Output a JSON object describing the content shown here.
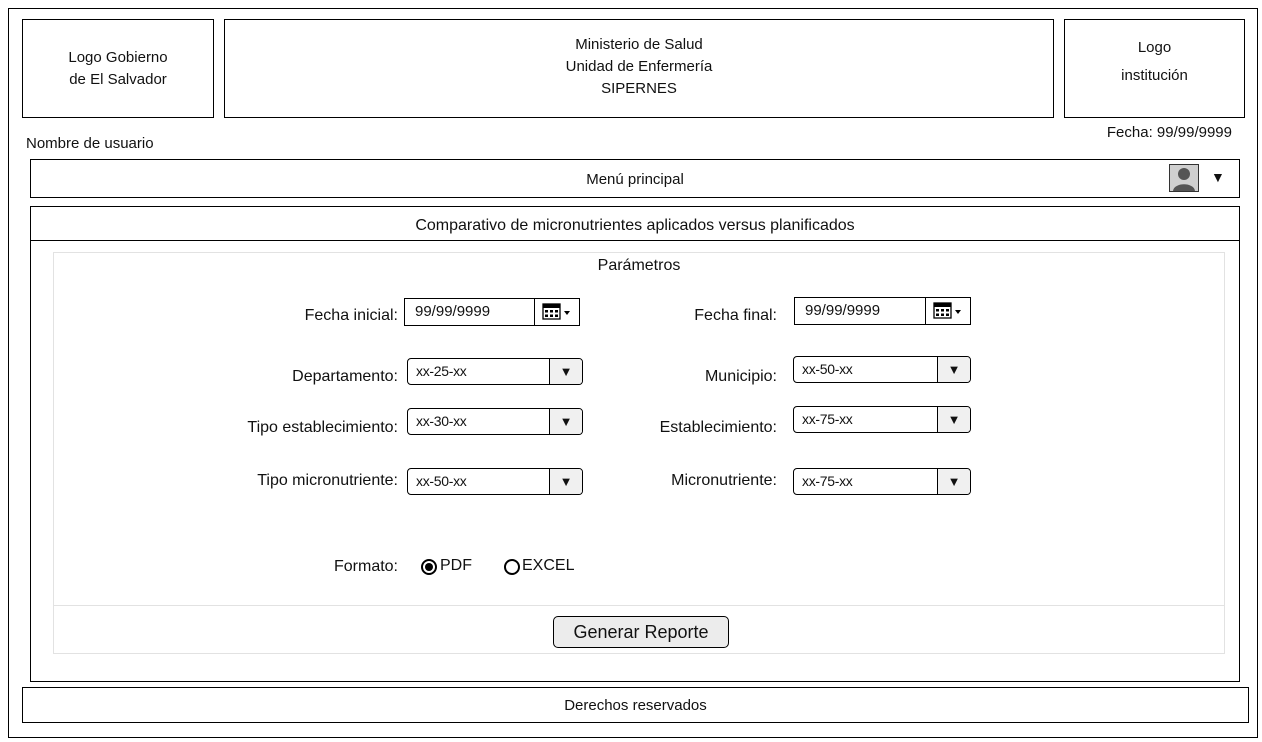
{
  "header": {
    "gov_logo": "Logo Gobierno de El Salvador",
    "gov_logo_line1": "Logo Gobierno",
    "gov_logo_line2": "de El Salvador",
    "ministry_line1": "Ministerio de Salud",
    "ministry_line2": "Unidad de Enfermería",
    "ministry_line3": "SIPERNES",
    "inst_logo_line1": "Logo",
    "inst_logo_line2": "institución"
  },
  "user": {
    "name_label": "Nombre de usuario",
    "date_label": "Fecha: 99/99/9999"
  },
  "menu": {
    "label": "Menú principal",
    "caret": "▼"
  },
  "panel": {
    "title": "Comparativo de micronutrientes aplicados versus planificados",
    "params_title": "Parámetros",
    "fecha_inicial": {
      "label": "Fecha inicial:",
      "value": "99/99/9999"
    },
    "fecha_final": {
      "label": "Fecha final:",
      "value": "99/99/9999"
    },
    "departamento": {
      "label": "Departamento:",
      "value": "xx-25-xx"
    },
    "municipio": {
      "label": "Municipio:",
      "value": "xx-50-xx"
    },
    "tipo_establecimiento": {
      "label": "Tipo establecimiento:",
      "value": "xx-30-xx"
    },
    "establecimiento": {
      "label": "Establecimiento:",
      "value": "xx-75-xx"
    },
    "tipo_micronutriente": {
      "label": "Tipo micronutriente:",
      "value": "xx-50-xx"
    },
    "micronutriente": {
      "label": "Micronutriente:",
      "value": "xx-75-xx"
    },
    "formato": {
      "label": "Formato:",
      "options": [
        "PDF",
        "EXCEL"
      ],
      "selected": "PDF"
    },
    "generate_button": "Generar Reporte"
  },
  "footer": {
    "label": "Derechos reservados"
  },
  "icons": {
    "calendar": "calendar-icon",
    "user": "user-avatar-icon",
    "dropdown": "chevron-down-icon"
  }
}
